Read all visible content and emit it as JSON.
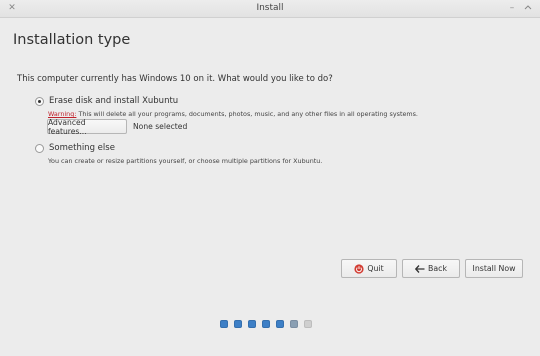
{
  "window": {
    "title": "Install"
  },
  "page": {
    "title": "Installation type",
    "prompt": "This computer currently has Windows 10 on it. What would you like to do?"
  },
  "options": {
    "erase": {
      "label": "Erase disk and install Xubuntu",
      "selected": true,
      "warning_word": "Warning:",
      "warning_text": " This will delete all your programs, documents, photos, music, and any other files in all operating systems.",
      "advanced_button": "Advanced features...",
      "advanced_status": "None selected"
    },
    "something_else": {
      "label": "Something else",
      "selected": false,
      "description": "You can create or resize partitions yourself, or choose multiple partitions for Xubuntu."
    }
  },
  "buttons": {
    "quit": "Quit",
    "back": "Back",
    "install_now": "Install Now"
  },
  "icons": {
    "quit": "power-icon",
    "back": "arrow-left-icon"
  },
  "progress": {
    "steps": [
      "done",
      "done",
      "done",
      "done",
      "done",
      "current",
      "todo"
    ]
  },
  "colors": {
    "warning": "#c0202a",
    "quit_icon": "#d23c32",
    "progress_done": "#3d7fc6"
  }
}
